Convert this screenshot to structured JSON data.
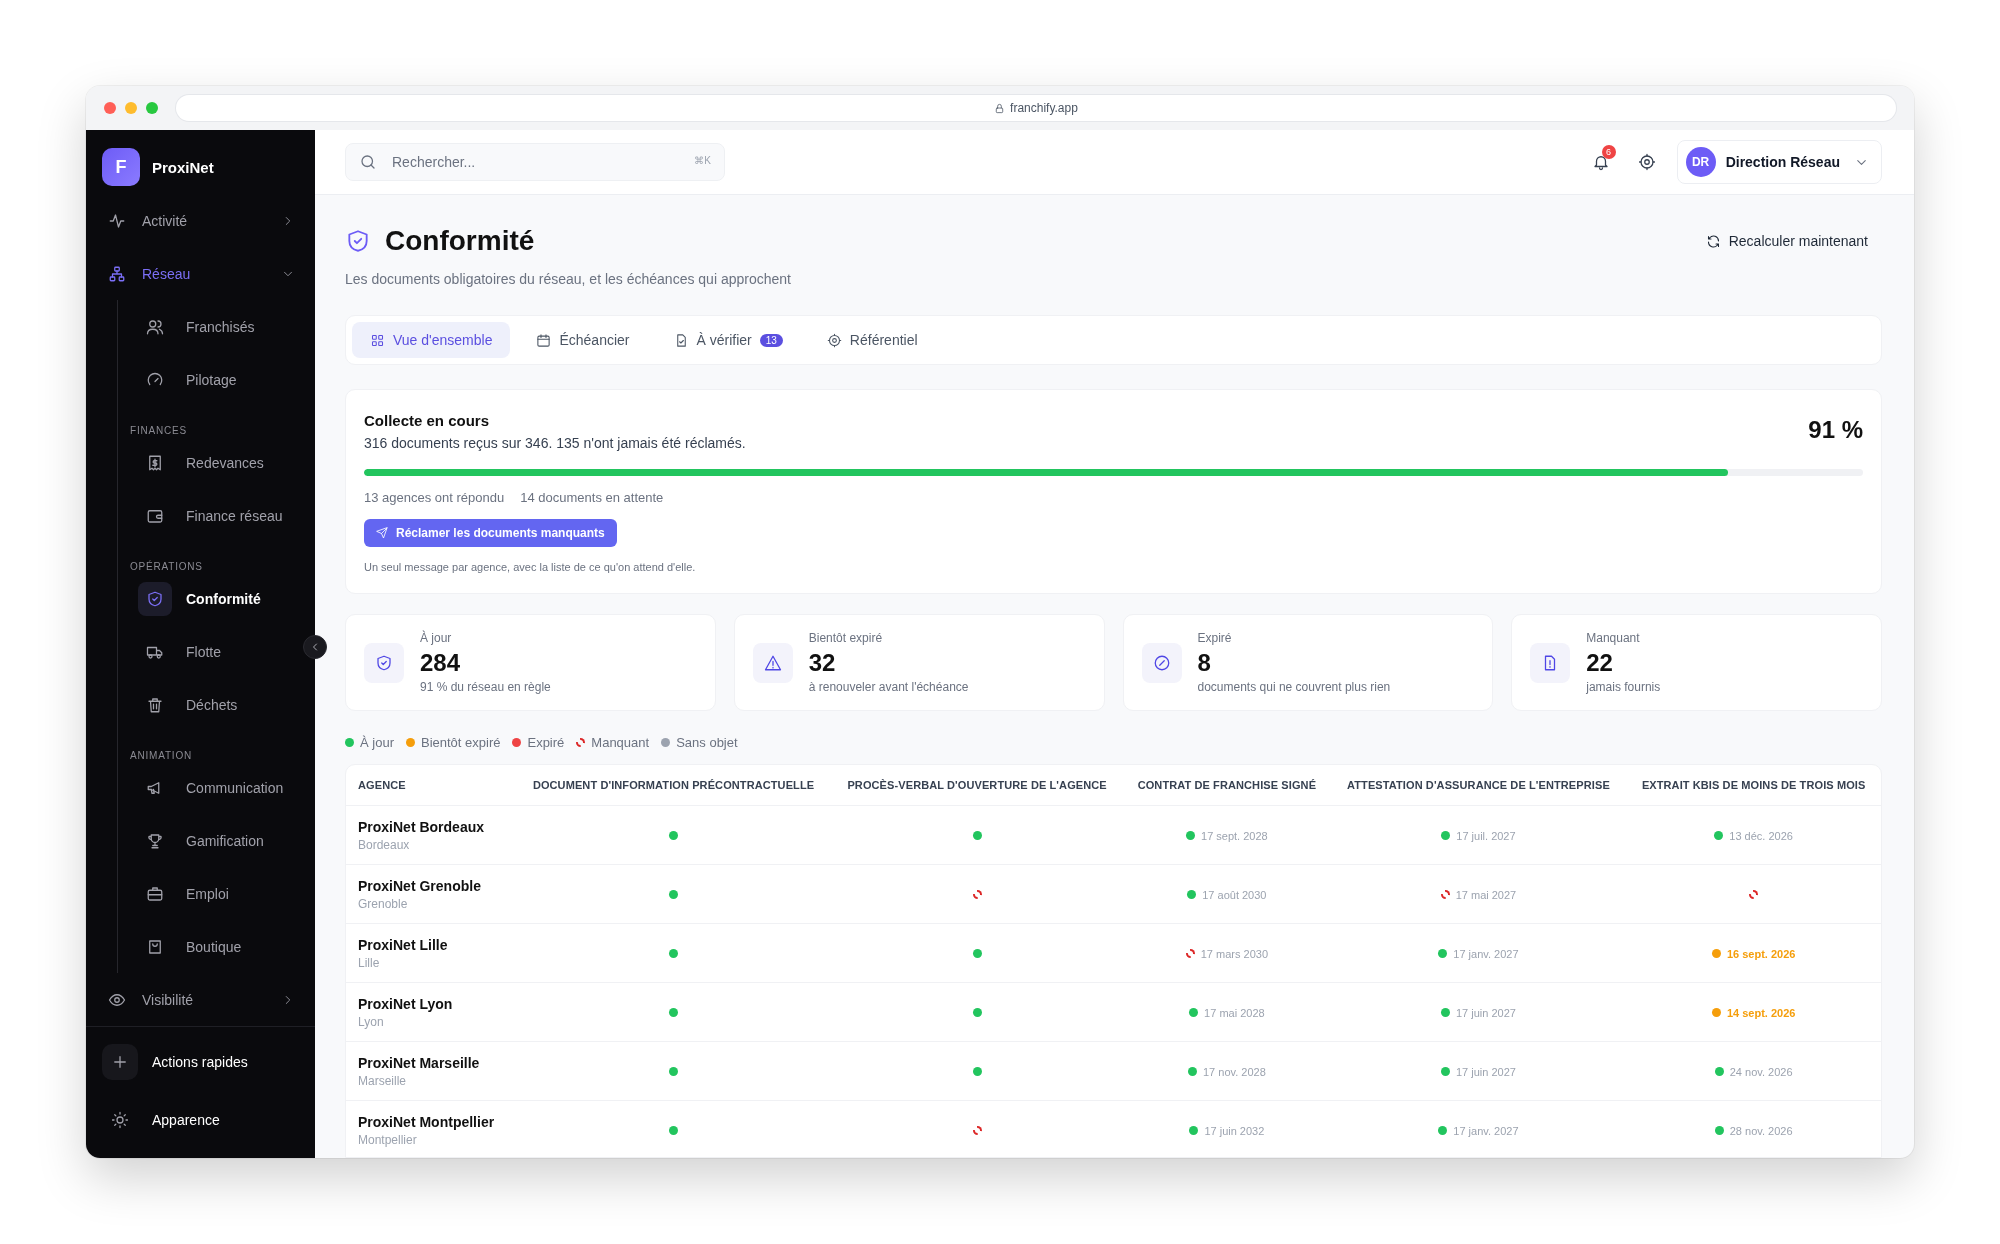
{
  "browser": {
    "url": "franchify.app"
  },
  "sidebar": {
    "brand_initial": "F",
    "brand_name": "ProxiNet",
    "items": [
      {
        "label": "Activité",
        "selected": false,
        "expanded": false
      },
      {
        "label": "Réseau",
        "selected": true,
        "expanded": true,
        "children": [
          {
            "kind": "link",
            "label": "Franchisés",
            "selected": false
          },
          {
            "kind": "link",
            "label": "Pilotage",
            "selected": false
          },
          {
            "kind": "heading",
            "label": "FINANCES"
          },
          {
            "kind": "link",
            "label": "Redevances",
            "selected": false
          },
          {
            "kind": "link",
            "label": "Finance réseau",
            "selected": false
          },
          {
            "kind": "heading",
            "label": "OPÉRATIONS"
          },
          {
            "kind": "link",
            "label": "Conformité",
            "selected": true
          },
          {
            "kind": "link",
            "label": "Flotte",
            "selected": false
          },
          {
            "kind": "link",
            "label": "Déchets",
            "selected": false
          },
          {
            "kind": "heading",
            "label": "ANIMATION"
          },
          {
            "kind": "link",
            "label": "Communication",
            "selected": false
          },
          {
            "kind": "link",
            "label": "Gamification",
            "selected": false
          },
          {
            "kind": "link",
            "label": "Emploi",
            "selected": false
          },
          {
            "kind": "link",
            "label": "Boutique",
            "selected": false
          }
        ]
      },
      {
        "label": "Visibilité",
        "selected": false,
        "expanded": false
      }
    ],
    "footer": [
      {
        "label": "Actions rapides"
      },
      {
        "label": "Apparence"
      }
    ]
  },
  "topbar": {
    "search_placeholder": "Rechercher...",
    "shortcut": "⌘K",
    "notifications": "6",
    "user_initials": "DR",
    "user_name": "Direction Réseau"
  },
  "page": {
    "title": "Conformité",
    "subtitle": "Les documents obligatoires du réseau, et les échéances qui approchent",
    "action": "Recalculer maintenant"
  },
  "tabs": [
    {
      "label": "Vue d'ensemble",
      "selected": true
    },
    {
      "label": "Échéancier",
      "selected": false
    },
    {
      "label": "À vérifier",
      "selected": false,
      "badge": "13"
    },
    {
      "label": "Référentiel",
      "selected": false
    }
  ],
  "collection": {
    "title": "Collecte en cours",
    "summary": "316 documents reçus sur 346. 135 n'ont jamais été réclamés.",
    "percent": "91 %",
    "level": 0.91,
    "stats": [
      "13 agences ont répondu",
      "14 documents en attente"
    ],
    "button": "Réclamer les documents manquants",
    "note": "Un seul message par agence, avec la liste de ce qu'on attend d'elle."
  },
  "stat_cards": [
    {
      "label": "À jour",
      "value": "284",
      "caption": "91 % du réseau en règle"
    },
    {
      "label": "Bientôt expiré",
      "value": "32",
      "caption": "à renouveler avant l'échéance"
    },
    {
      "label": "Expiré",
      "value": "8",
      "caption": "documents qui ne couvrent plus rien"
    },
    {
      "label": "Manquant",
      "value": "22",
      "caption": "jamais fournis"
    }
  ],
  "legend": [
    {
      "kind": "ok",
      "label": "À jour"
    },
    {
      "kind": "soon",
      "label": "Bientôt expiré"
    },
    {
      "kind": "expired",
      "label": "Expiré"
    },
    {
      "kind": "missing",
      "label": "Manquant"
    },
    {
      "kind": "na",
      "label": "Sans objet"
    }
  ],
  "table": {
    "columns": [
      "AGENCE",
      "DOCUMENT D'INFORMATION PRÉCONTRACTUELLE",
      "PROCÈS-VERBAL D'OUVERTURE DE L'AGENCE",
      "CONTRAT DE FRANCHISE SIGNÉ",
      "ATTESTATION D'ASSURANCE DE L'ENTREPRISE",
      "EXTRAIT KBIS DE MOINS DE TROIS MOIS"
    ],
    "rows": [
      {
        "cells": [
          {
            "kind": "agency",
            "name": "ProxiNet Bordeaux",
            "city": "Bordeaux"
          },
          {
            "kind": "ok"
          },
          {
            "kind": "ok"
          },
          {
            "kind": "ok",
            "date": "17 sept. 2028"
          },
          {
            "kind": "ok",
            "date": "17 juil. 2027"
          },
          {
            "kind": "ok",
            "date": "13 déc. 2026"
          }
        ]
      },
      {
        "cells": [
          {
            "kind": "agency",
            "name": "ProxiNet Grenoble",
            "city": "Grenoble"
          },
          {
            "kind": "ok"
          },
          {
            "kind": "missing"
          },
          {
            "kind": "ok",
            "date": "17 août 2030"
          },
          {
            "kind": "missing",
            "date": "17 mai 2027"
          },
          {
            "kind": "missing"
          }
        ]
      },
      {
        "cells": [
          {
            "kind": "agency",
            "name": "ProxiNet Lille",
            "city": "Lille"
          },
          {
            "kind": "ok"
          },
          {
            "kind": "ok"
          },
          {
            "kind": "missing",
            "date": "17 mars 2030"
          },
          {
            "kind": "ok",
            "date": "17 janv. 2027"
          },
          {
            "kind": "soon",
            "date": "16 sept. 2026"
          }
        ]
      },
      {
        "cells": [
          {
            "kind": "agency",
            "name": "ProxiNet Lyon",
            "city": "Lyon"
          },
          {
            "kind": "ok"
          },
          {
            "kind": "ok"
          },
          {
            "kind": "ok",
            "date": "17 mai 2028"
          },
          {
            "kind": "ok",
            "date": "17 juin 2027"
          },
          {
            "kind": "soon",
            "date": "14 sept. 2026"
          }
        ]
      },
      {
        "cells": [
          {
            "kind": "agency",
            "name": "ProxiNet Marseille",
            "city": "Marseille"
          },
          {
            "kind": "ok"
          },
          {
            "kind": "ok"
          },
          {
            "kind": "ok",
            "date": "17 nov. 2028"
          },
          {
            "kind": "ok",
            "date": "17 juin 2027"
          },
          {
            "kind": "ok",
            "date": "24 nov. 2026"
          }
        ]
      },
      {
        "cells": [
          {
            "kind": "agency",
            "name": "ProxiNet Montpellier",
            "city": "Montpellier"
          },
          {
            "kind": "ok"
          },
          {
            "kind": "missing"
          },
          {
            "kind": "ok",
            "date": "17 juin 2032"
          },
          {
            "kind": "ok",
            "date": "17 janv. 2027"
          },
          {
            "kind": "ok",
            "date": "28 nov. 2026"
          }
        ]
      }
    ]
  }
}
